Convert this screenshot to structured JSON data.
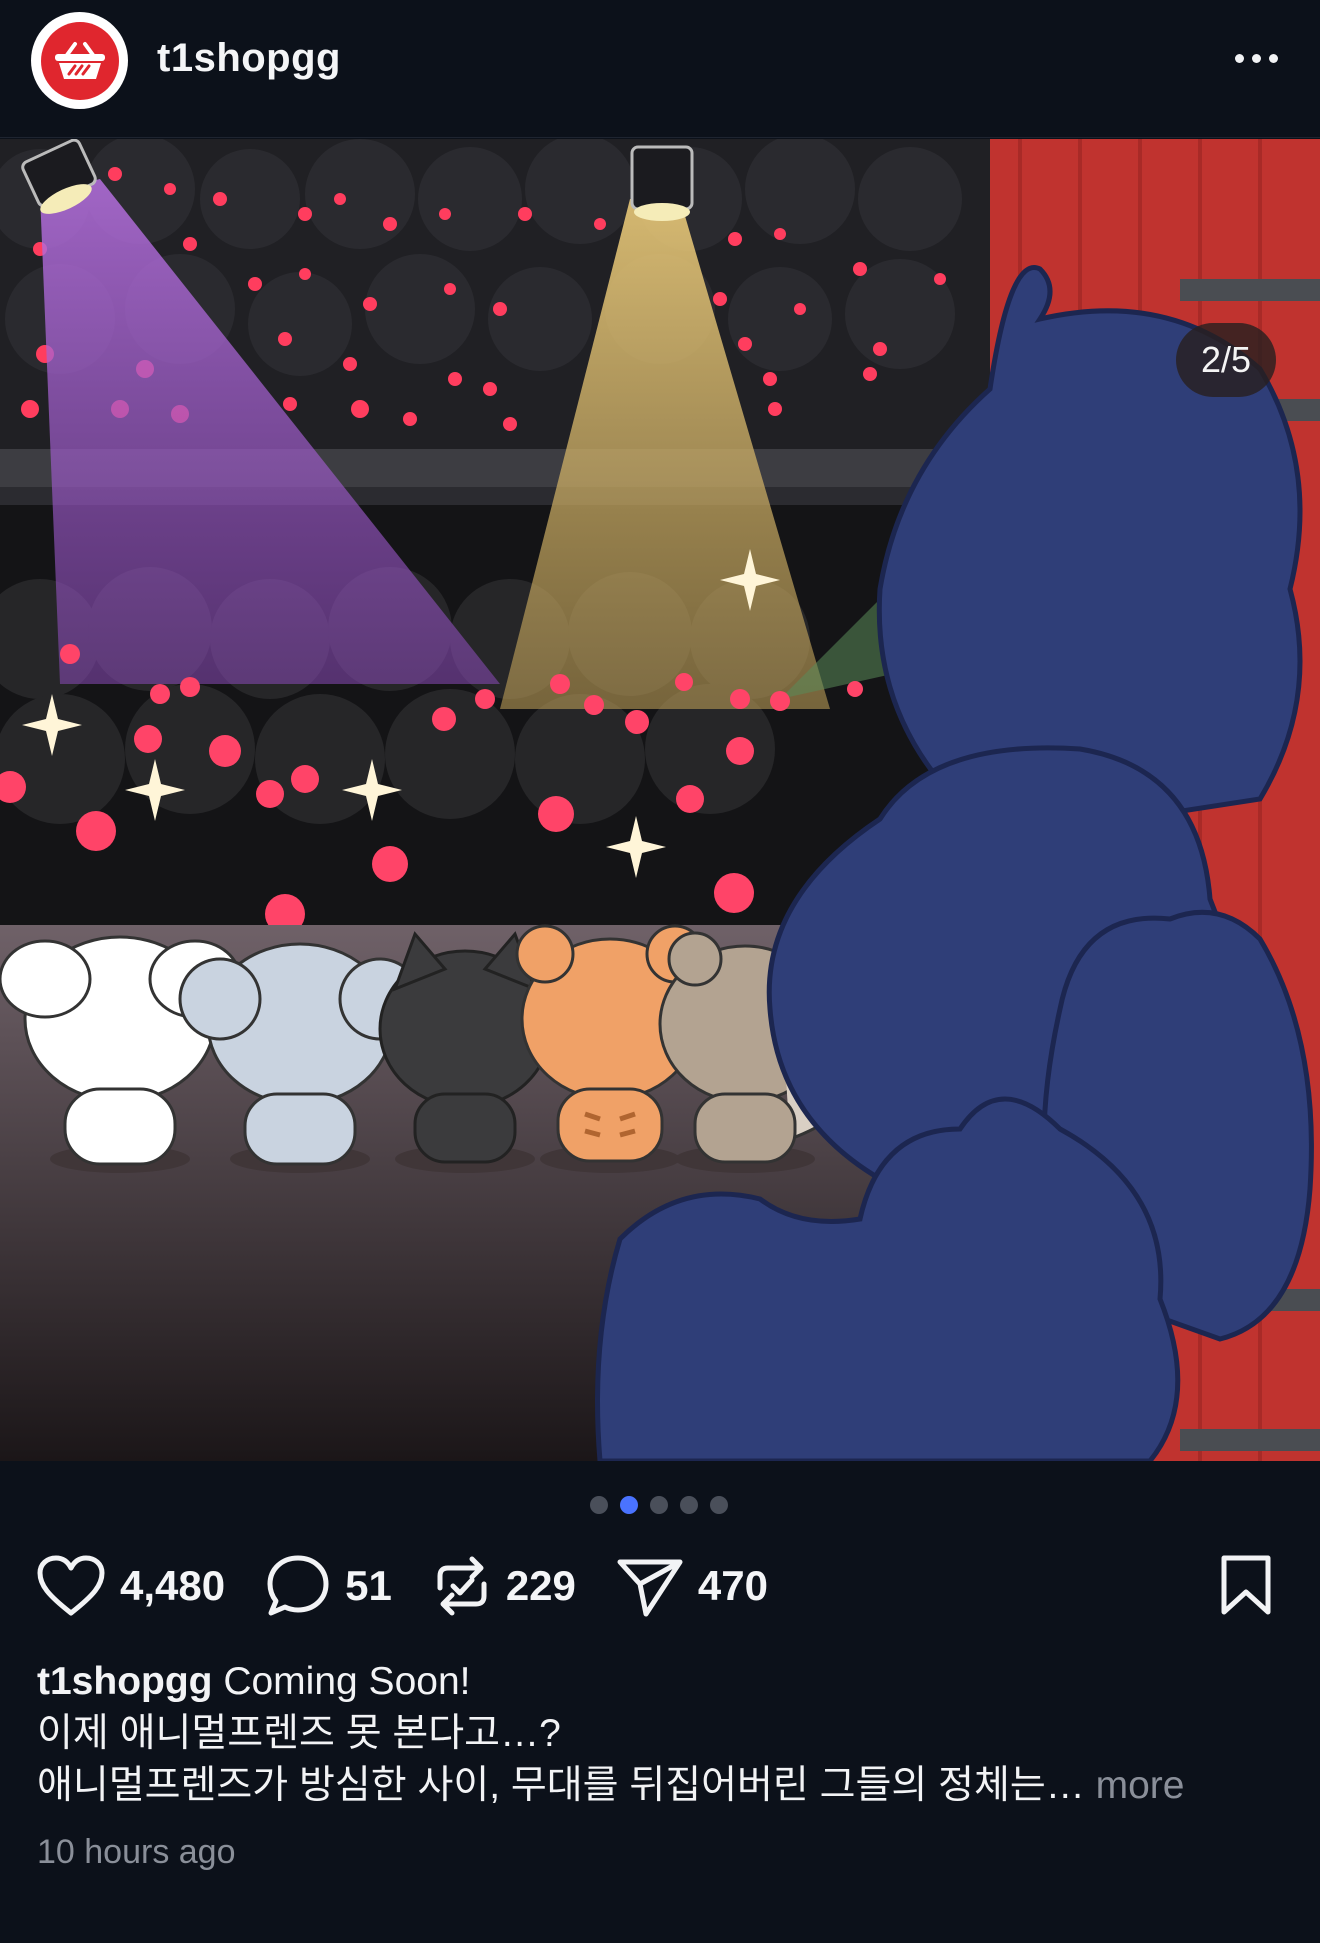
{
  "header": {
    "username": "t1shopgg",
    "avatar_icon": "shopping-basket-icon",
    "more_icon": "more-horizontal-icon"
  },
  "post": {
    "image_counter": "2/5",
    "carousel": {
      "total": 5,
      "active_index": 1
    },
    "image_description_colors": {
      "accent_red": "#e0262e",
      "navy_silhouette": "#2f3e78"
    }
  },
  "actions": {
    "like_icon": "heart-icon",
    "like_count": "4,480",
    "comment_icon": "comment-bubble-icon",
    "comment_count": "51",
    "repost_icon": "repost-icon",
    "repost_count": "229",
    "share_icon": "send-icon",
    "share_count": "470",
    "bookmark_icon": "bookmark-icon"
  },
  "caption": {
    "username": "t1shopgg",
    "line1": "Coming Soon!",
    "line2": "이제 애니멀프렌즈 못 본다고…?",
    "line3": "애니멀프렌즈가 방심한 사이, 무대를 뒤집어버린 그들의 정체는…",
    "more_label": "more"
  },
  "timestamp": "10 hours ago"
}
